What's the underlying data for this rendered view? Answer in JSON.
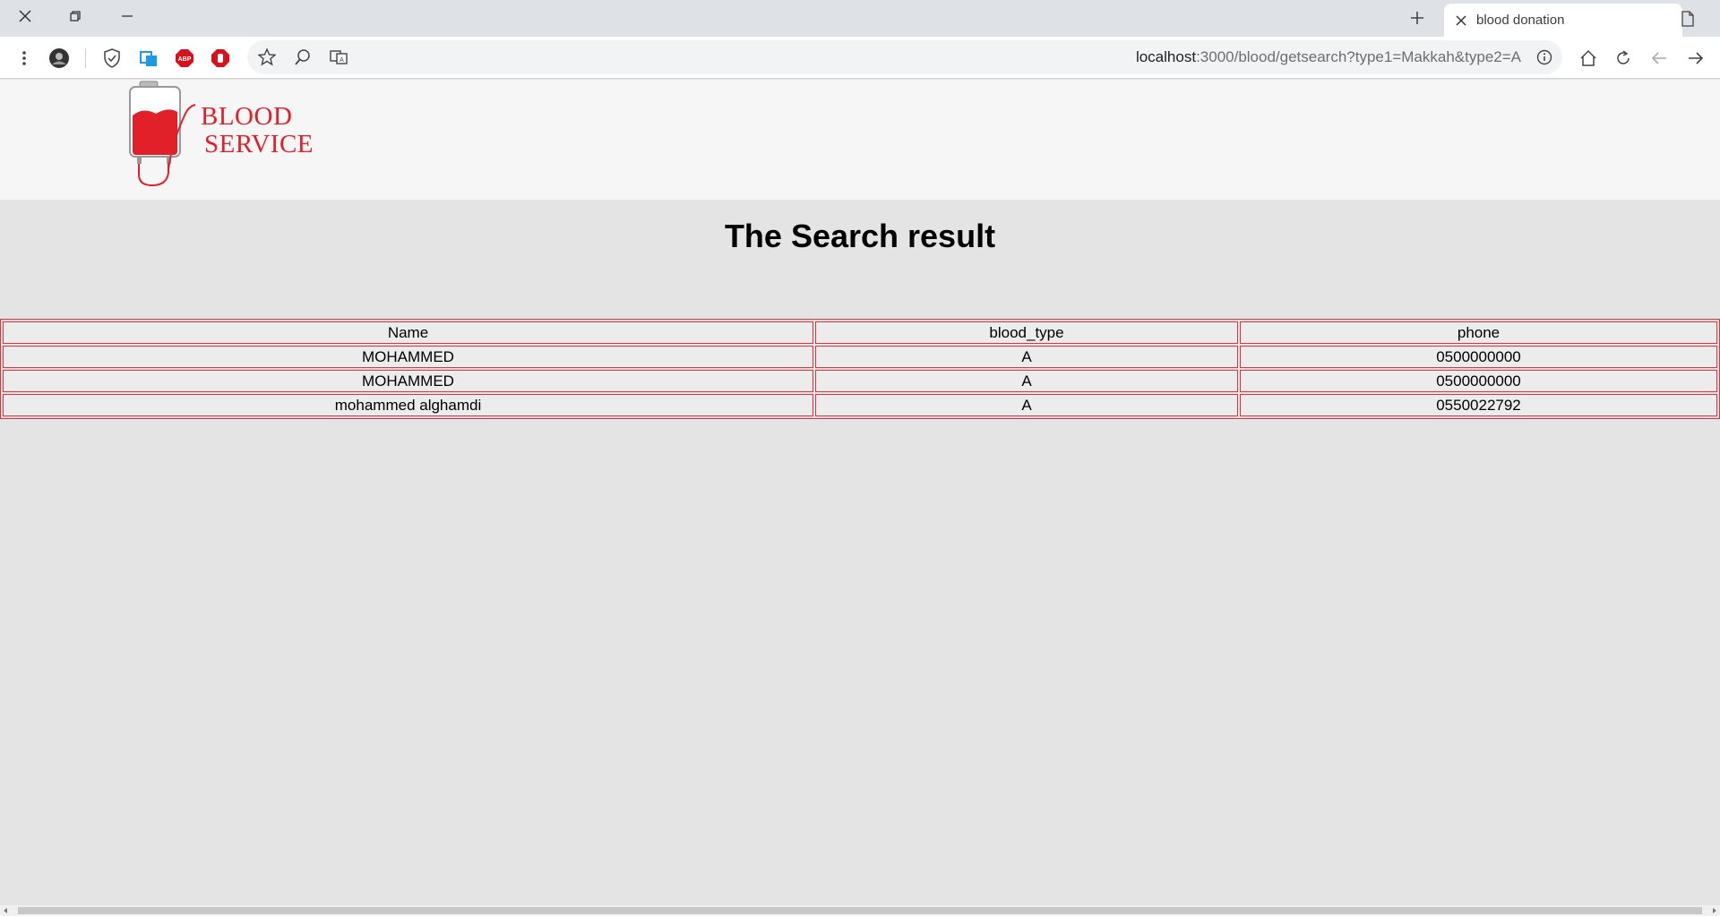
{
  "browser": {
    "tab_title": "blood donation",
    "url_host": "localhost",
    "url_path": ":3000/blood/getsearch?type1=Makkah&type2=A"
  },
  "logo": {
    "line1": "BLOOD",
    "line2": "SERVICE",
    "color": "#e2202a"
  },
  "page": {
    "title": "The Search result"
  },
  "table": {
    "headers": [
      "Name",
      "blood_type",
      "phone"
    ],
    "rows": [
      [
        "MOHAMMED",
        "A",
        "0500000000"
      ],
      [
        "MOHAMMED",
        "A",
        "0500000000"
      ],
      [
        "mohammed alghamdi",
        "A",
        "0550022792"
      ]
    ],
    "border_color": "#e0343c"
  },
  "icons": {
    "window_controls": [
      "close-icon",
      "restore-icon",
      "minimize-icon"
    ],
    "toolbar": [
      "menu-dots-icon",
      "profile-avatar-icon",
      "shield-icon",
      "screenshot-extension-icon",
      "adblock-icon",
      "stop-hand-icon",
      "star-icon",
      "zoom-icon",
      "translate-icon",
      "info-icon",
      "home-icon",
      "reload-icon",
      "back-icon",
      "forward-icon"
    ]
  }
}
